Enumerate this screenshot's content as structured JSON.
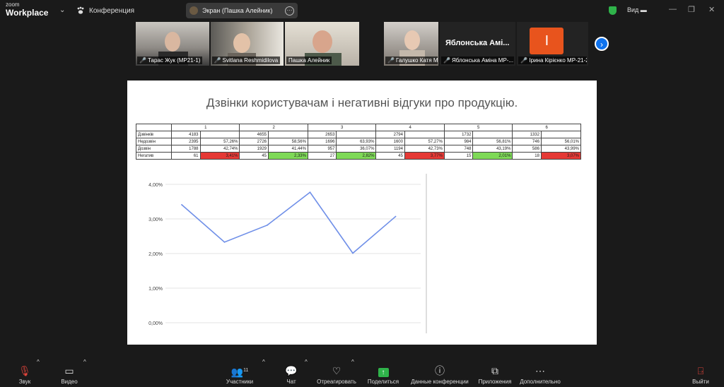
{
  "top": {
    "brand_small": "zoom",
    "brand_main": "Workplace",
    "meeting_title": "Конференция",
    "screen_share_label": "Экран (Пашка Алейник)",
    "view_label": "Вид"
  },
  "participants": [
    {
      "name": "Тарас Жук (МР21-1)"
    },
    {
      "name": "Svitlana Reshmidilova"
    },
    {
      "name": "Пашка Алейник"
    },
    {
      "name": "Галушко Катя МР-21-2"
    },
    {
      "name": "Яблонська Аміна МР-...",
      "display": "Яблонська Амі..."
    },
    {
      "name": "Ірина Кірієнко МР-21-2",
      "avatar_letter": "І"
    }
  ],
  "slide": {
    "title": "Дзвінки користувачам і негативні відгуки про продукцію.",
    "table": {
      "columns": [
        "1",
        "2",
        "3",
        "4",
        "5",
        "6"
      ],
      "rows": [
        {
          "label": "Дзвінків",
          "cells": [
            [
              "4183",
              ""
            ],
            [
              "4655",
              ""
            ],
            [
              "2653",
              ""
            ],
            [
              "2794",
              ""
            ],
            [
              "1732",
              ""
            ],
            [
              "1332",
              ""
            ]
          ]
        },
        {
          "label": "Недозвін",
          "cells": [
            [
              "2395",
              "57,26%"
            ],
            [
              "2726",
              "58,56%"
            ],
            [
              "1696",
              "63,93%"
            ],
            [
              "1600",
              "57,27%"
            ],
            [
              "984",
              "56,81%"
            ],
            [
              "746",
              "56,01%"
            ]
          ]
        },
        {
          "label": "Дозвін",
          "cells": [
            [
              "1788",
              "42,74%"
            ],
            [
              "1929",
              "41,44%"
            ],
            [
              "957",
              "36,07%"
            ],
            [
              "1194",
              "42,73%"
            ],
            [
              "748",
              "43,19%"
            ],
            [
              "586",
              "43,99%"
            ]
          ]
        },
        {
          "label": "Негатив",
          "cells": [
            [
              "61",
              "3,41%"
            ],
            [
              "45",
              "2,33%"
            ],
            [
              "27",
              "2,82%"
            ],
            [
              "45",
              "3,77%"
            ],
            [
              "15",
              "2,01%"
            ],
            [
              "18",
              "3,07%"
            ]
          ]
        }
      ],
      "negative_colors": [
        "#e53935",
        "#7ed957",
        "#7ed957",
        "#e53935",
        "#7ed957",
        "#e53935"
      ]
    }
  },
  "chart_data": {
    "type": "line",
    "x": [
      1,
      2,
      3,
      4,
      5,
      6
    ],
    "series": [
      {
        "values": [
          3.41,
          2.33,
          2.82,
          3.77,
          2.01,
          3.07
        ],
        "color": "#6f8fe8"
      }
    ],
    "ylim": [
      0,
      4
    ],
    "yticks": [
      "0,00%",
      "1,00%",
      "2,00%",
      "3,00%",
      "4,00%"
    ],
    "grid": true
  },
  "toolbar": {
    "audio": "Звук",
    "video": "Видео",
    "participants": "Участники",
    "participants_count": "11",
    "chat": "Чат",
    "react": "Отреагировать",
    "share": "Поделиться",
    "info": "Данные конференции",
    "apps": "Приложения",
    "more": "Дополнительно",
    "leave": "Выйти"
  }
}
